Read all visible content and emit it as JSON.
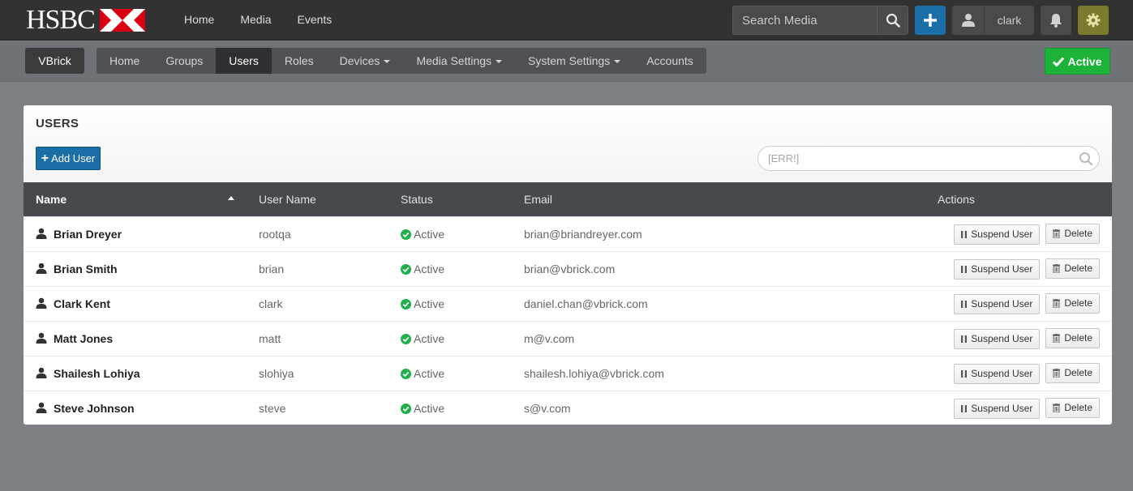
{
  "brand": {
    "logo_text": "HSBC"
  },
  "top_nav": [
    "Home",
    "Media",
    "Events"
  ],
  "search": {
    "placeholder": "Search Media"
  },
  "user": {
    "name": "clark"
  },
  "subnav": {
    "account_label": "VBrick",
    "items": [
      {
        "label": "Home",
        "active": false,
        "dropdown": false
      },
      {
        "label": "Groups",
        "active": false,
        "dropdown": false
      },
      {
        "label": "Users",
        "active": true,
        "dropdown": false
      },
      {
        "label": "Roles",
        "active": false,
        "dropdown": false
      },
      {
        "label": "Devices",
        "active": false,
        "dropdown": true
      },
      {
        "label": "Media Settings",
        "active": false,
        "dropdown": true
      },
      {
        "label": "System Settings",
        "active": false,
        "dropdown": true
      },
      {
        "label": "Accounts",
        "active": false,
        "dropdown": false
      }
    ],
    "status_label": "Active"
  },
  "panel": {
    "title": "USERS",
    "add_user_label": "Add User",
    "filter_placeholder": "[ERR!]"
  },
  "table": {
    "columns": [
      "Name",
      "User Name",
      "Status",
      "Email",
      "Actions"
    ],
    "suspend_label": "Suspend User",
    "delete_label": "Delete",
    "rows": [
      {
        "name": "Brian Dreyer",
        "username": "rootqa",
        "status": "Active",
        "email": "brian@briandreyer.com"
      },
      {
        "name": "Brian Smith",
        "username": "brian",
        "status": "Active",
        "email": "brian@vbrick.com"
      },
      {
        "name": "Clark Kent",
        "username": "clark",
        "status": "Active",
        "email": "daniel.chan@vbrick.com"
      },
      {
        "name": "Matt Jones",
        "username": "matt",
        "status": "Active",
        "email": "m@v.com"
      },
      {
        "name": "Shailesh Lohiya",
        "username": "slohiya",
        "status": "Active",
        "email": "shailesh.lohiya@vbrick.com"
      },
      {
        "name": "Steve Johnson",
        "username": "steve",
        "status": "Active",
        "email": "s@v.com"
      }
    ]
  },
  "colors": {
    "topbar": "#323232",
    "primary": "#1b6fa6",
    "success": "#1db339",
    "gear": "#7c7a2c",
    "status_ok": "#22b04a"
  },
  "icons": {
    "search": "search-icon",
    "plus": "plus-icon",
    "user": "user-icon",
    "bell": "bell-icon",
    "gear": "gear-icon",
    "check": "check-icon",
    "status": "check-circle-icon",
    "pause": "pause-icon",
    "trash": "trash-icon"
  }
}
